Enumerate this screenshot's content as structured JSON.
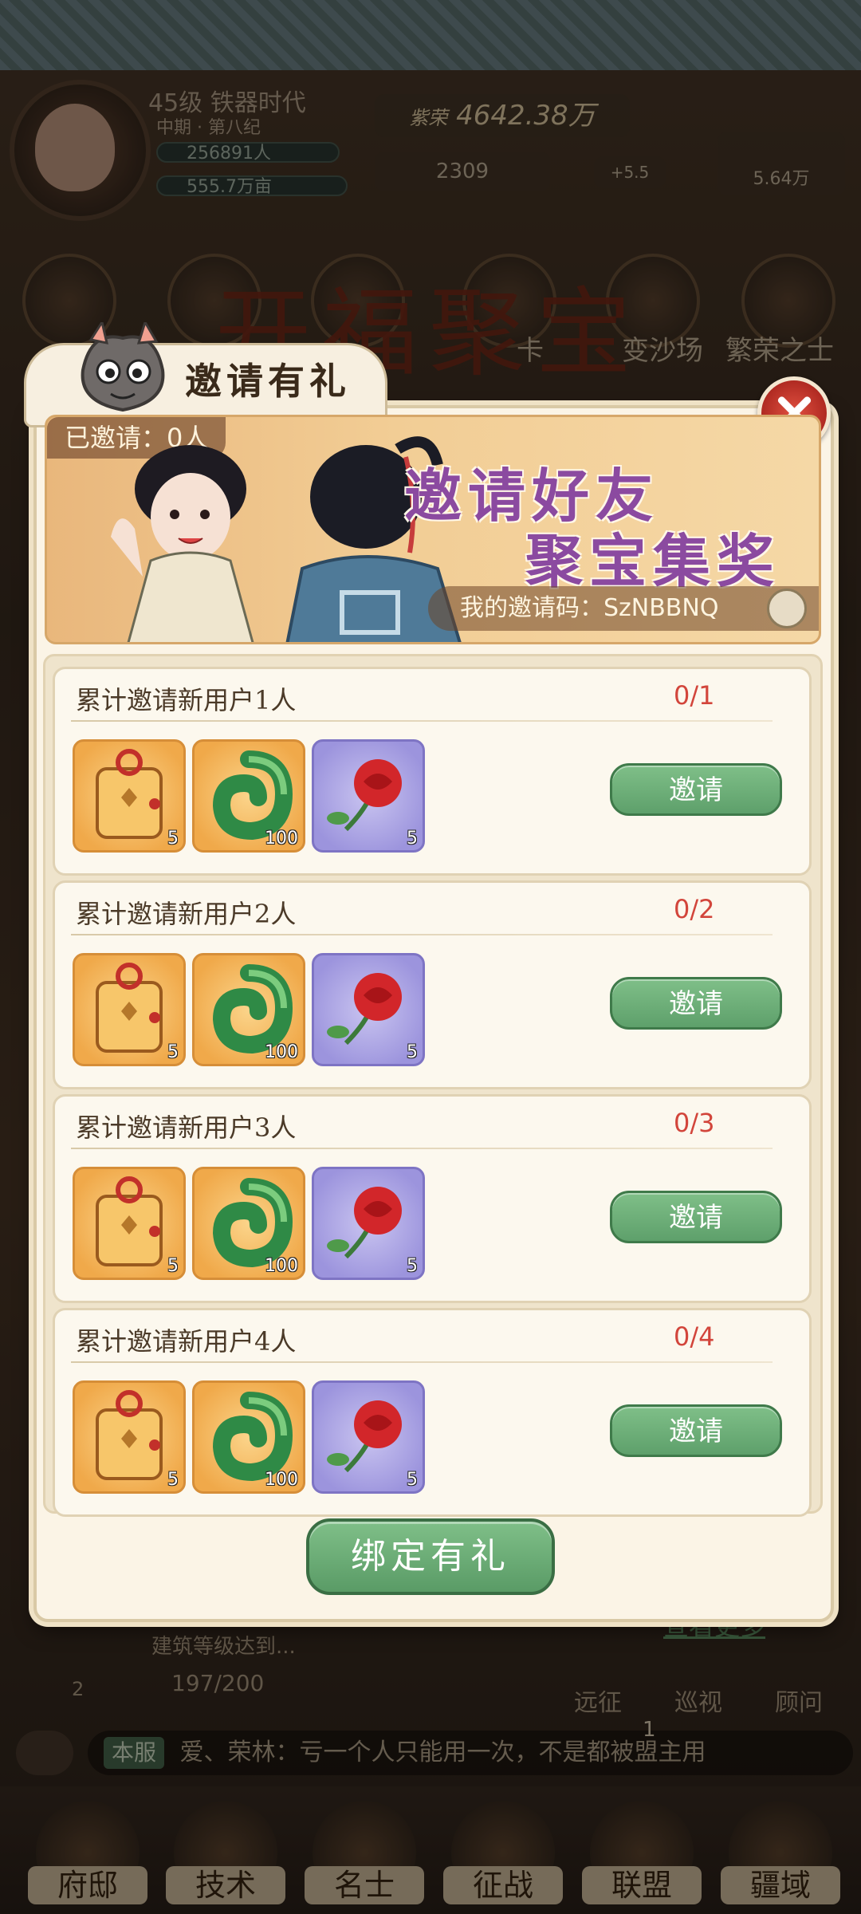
{
  "header": {
    "level_era": "45级 铁器时代",
    "sub_era": "中期 · 第八纪",
    "population": "256891人",
    "land": "555.7万亩",
    "gold": "4642.38万",
    "gold_tag": "紫荣",
    "jade": "2309",
    "food_rate": "+5.5",
    "food_total": "5.64万"
  },
  "background": {
    "event_title": "开福聚宝",
    "side_labels": [
      "卡",
      "变沙场",
      "繁荣之士"
    ],
    "see_more": "查看更多",
    "task_text": "建筑等级达到...",
    "task_progress": "197/200",
    "task_badge": "2",
    "quick_links": [
      "远征",
      "巡视",
      "顾问"
    ]
  },
  "chat": {
    "server_tag": "本服",
    "message": "爱、荣林：亏一个人只能用一次，不是都被盟主用",
    "unread": "1"
  },
  "bottom_nav": [
    "府邸",
    "技术",
    "名士",
    "征战",
    "联盟",
    "疆域"
  ],
  "modal": {
    "title": "邀请有礼",
    "invited_label": "已邀请：0人",
    "banner_line1": "邀请好友",
    "banner_line2": "聚宝集奖",
    "invite_code_label": "我的邀请码：SzNBBNQ",
    "rows": [
      {
        "title": "累计邀请新用户1人",
        "progress": "0/1",
        "button": "邀请",
        "items": [
          {
            "icon": "lucky-bag-icon",
            "count": "5"
          },
          {
            "icon": "green-jade-icon",
            "count": "100"
          },
          {
            "icon": "rose-icon",
            "count": "5"
          }
        ]
      },
      {
        "title": "累计邀请新用户2人",
        "progress": "0/2",
        "button": "邀请",
        "items": [
          {
            "icon": "lucky-bag-icon",
            "count": "5"
          },
          {
            "icon": "green-jade-icon",
            "count": "100"
          },
          {
            "icon": "rose-icon",
            "count": "5"
          }
        ]
      },
      {
        "title": "累计邀请新用户3人",
        "progress": "0/3",
        "button": "邀请",
        "items": [
          {
            "icon": "lucky-bag-icon",
            "count": "5"
          },
          {
            "icon": "green-jade-icon",
            "count": "100"
          },
          {
            "icon": "rose-icon",
            "count": "5"
          }
        ]
      },
      {
        "title": "累计邀请新用户4人",
        "progress": "0/4",
        "button": "邀请",
        "items": [
          {
            "icon": "lucky-bag-icon",
            "count": "5"
          },
          {
            "icon": "green-jade-icon",
            "count": "100"
          },
          {
            "icon": "rose-icon",
            "count": "5"
          }
        ]
      }
    ],
    "bind_button": "绑定有礼"
  },
  "colors": {
    "accent_green": "#5ea06b",
    "progress_red": "#d2453b",
    "banner_purple": "#8b4aa0",
    "close_red": "#b02a22"
  }
}
